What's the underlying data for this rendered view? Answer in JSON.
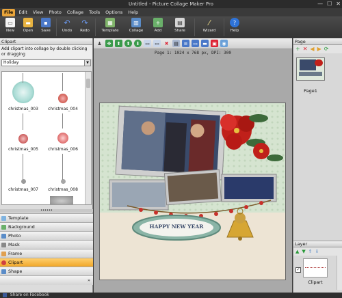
{
  "window": {
    "title": "Untitled - Picture Collage Maker Pro",
    "minimize": "—",
    "maximize": "☐",
    "close": "✕"
  },
  "menu": [
    "File",
    "Edit",
    "View",
    "Photo",
    "Collage",
    "Tools",
    "Options",
    "Help"
  ],
  "toolbar": {
    "new": "New",
    "open": "Open",
    "save": "Save",
    "undo": "Undo",
    "redo": "Redo",
    "template": "Template",
    "collage": "Collage",
    "add": "Add",
    "share": "Share",
    "wizard": "Wizard",
    "help": "Help"
  },
  "left_panel": {
    "title": "Clipart",
    "hint": "Add clipart into collage by double clicking or dragging",
    "category": "Holiday",
    "items": [
      "christmas_003",
      "christmas_004",
      "christmas_005",
      "christmas_006",
      "christmas_007",
      "christmas_008"
    ],
    "tabs": [
      "Template",
      "Background",
      "Photo",
      "Mask",
      "Frame",
      "Clipart",
      "Shape"
    ],
    "active_tab": "Clipart"
  },
  "center": {
    "page_info": "Page 1: 1024 x 768 px, DPI: 300",
    "card_text": "HAPPY NEW YEAR"
  },
  "right_panel": {
    "page_title": "Page",
    "page_label": "Page1",
    "layer_title": "Layer",
    "layer_label": "Clipart"
  },
  "status": {
    "share": "Share on Facebook"
  },
  "colors": {
    "accent": "#f0a72a",
    "canvas_bg": "#dfe9dc",
    "dark_bar": "#3a3a3a"
  }
}
